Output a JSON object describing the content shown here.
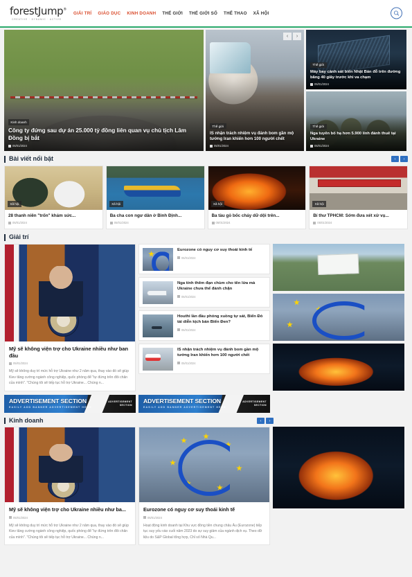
{
  "header": {
    "logo": "forestJump",
    "logo_tm": "®",
    "logo_tagline": "Creative · Dynamic · Active",
    "nav": [
      {
        "label": "GIẢI TRÍ"
      },
      {
        "label": "GIÁO DỤC"
      },
      {
        "label": "KINH DOANH"
      },
      {
        "label": "THẾ GIỚI"
      },
      {
        "label": "THẾ GIỚI SỐ"
      },
      {
        "label": "THỂ THAO"
      },
      {
        "label": "XÃ HỘI"
      }
    ],
    "search_icon": "search-icon"
  },
  "hero": {
    "prev_label": "‹",
    "next_label": "›",
    "main": {
      "tag": "Kinh doanh",
      "title": "Công ty đứng sau dự án 25.000 tỷ đồng liên quan vụ chủ tịch Lâm Đồng bị bắt",
      "date": "05/01/2024"
    },
    "mid": {
      "tag": "Thế giới",
      "title": "IS nhận trách nhiệm vụ đánh bom gần mộ tướng Iran khiến hơn 100 người chết",
      "date": "05/01/2024"
    },
    "small": [
      {
        "tag": "Thế giới",
        "title": "Máy bay cảnh sát biển Nhật Bản đỗ trên đường băng 40 giây trước khi va chạm",
        "date": "05/01/2024"
      },
      {
        "tag": "Thế giới",
        "title": "Nga tuyên bố hạ hơn 5.900 lính đánh thuê tại Ukraine",
        "date": "05/01/2024"
      }
    ]
  },
  "featured": {
    "section_title": "Bài viết nổi bật",
    "prev_label": "‹",
    "next_label": "›",
    "cards": [
      {
        "tag": "Xã hội",
        "title": "28 thanh niên \"trốn\" khám sức...",
        "date": "05/01/2024"
      },
      {
        "tag": "Xã hội",
        "title": "Ba cha con ngư dân ở Bình Định...",
        "date": "05/01/2024"
      },
      {
        "tag": "Xã hội",
        "title": "Ba tàu gỗ bốc cháy dữ dội trên...",
        "date": "05/01/2024"
      },
      {
        "tag": "Xã hội",
        "title": "Bí thư TPHCM: Sớm đưa xét xử vụ...",
        "date": "05/01/2024"
      }
    ]
  },
  "giaitri": {
    "section_title": "Giải trí",
    "feature": {
      "title": "Mỹ sẽ không viện trợ cho Ukraine nhiều như ban đầu",
      "date": "05/01/2024",
      "excerpt": "Mỹ sẽ không duy trì mức hỗ trợ Ukraine như 2 năm qua, thay vào đó sẽ giúp Kiev tăng cường ngành công nghiệp, quốc phòng để \"tự đứng trên đôi chân của mình\". \"Chúng tôi sẽ tiếp tục hỗ trợ Ukraine... Chúng n..."
    },
    "items": [
      {
        "title": "Eurozone có nguy cơ suy thoái kinh tế",
        "date": "05/01/2024"
      },
      {
        "title": "Nga tính thêm đạn chùm cho tên lửa mà Ukraine chưa thể đánh chặn",
        "date": "05/01/2024"
      },
      {
        "title": "Houthi lần đầu phóng xuồng tự sát, Biển Đỏ tái diễn kịch bản Biển Đen?",
        "date": "05/01/2024"
      },
      {
        "title": "IS nhận trách nhiệm vụ đánh bom gần mộ tướng Iran khiến hơn 100 người chết",
        "date": "05/01/2024"
      }
    ]
  },
  "ads": {
    "banners": [
      {
        "title": "ADVERTISEMENT SECTION",
        "subtitle": "EASILY ADD BANNER ADVERTISEMENT HERE",
        "side_line1": "ADVERTISEMENT",
        "side_line2": "SECTION"
      },
      {
        "title": "ADVERTISEMENT SECTION",
        "subtitle": "EASILY ADD BANNER ADVERTISEMENT HERE",
        "side_line1": "ADVERTISEMENT",
        "side_line2": "SECTION"
      }
    ]
  },
  "kinhdoanh": {
    "section_title": "Kinh doanh",
    "prev_label": "‹",
    "next_label": "›",
    "cards": [
      {
        "title": "Mỹ sẽ không viện trợ cho Ukraine nhiều như ba...",
        "date": "05/01/2024",
        "excerpt": "Mỹ sẽ không duy trì mức hỗ trợ Ukraine như 2 năm qua, thay vào đó sẽ giúp Kiev tăng cường ngành công nghiệp, quốc phòng để \"tự đứng trên đôi chân của mình\". \"Chúng tôi sẽ tiếp tục hỗ trợ Ukraine... Chúng n..."
      },
      {
        "title": "Eurozone có nguy cơ suy thoái kinh tế",
        "date": "05/01/2024",
        "excerpt": "Hoạt động kinh doanh tại Khu vực đồng tiền chung châu Âu (Eurozone) tiếp tục suy yếu vào cuối năm 2023 do sự suy giảm của ngành dịch vụ. Theo dữ liệu do S&P Global tổng hợp, Chỉ số Nhà Qu..."
      }
    ]
  },
  "colors": {
    "nav_accent": "#d94b2b",
    "header_underline": "#2aa96b",
    "arrow_blue": "#2f6fc0",
    "section_title": "#1c2a3a"
  }
}
